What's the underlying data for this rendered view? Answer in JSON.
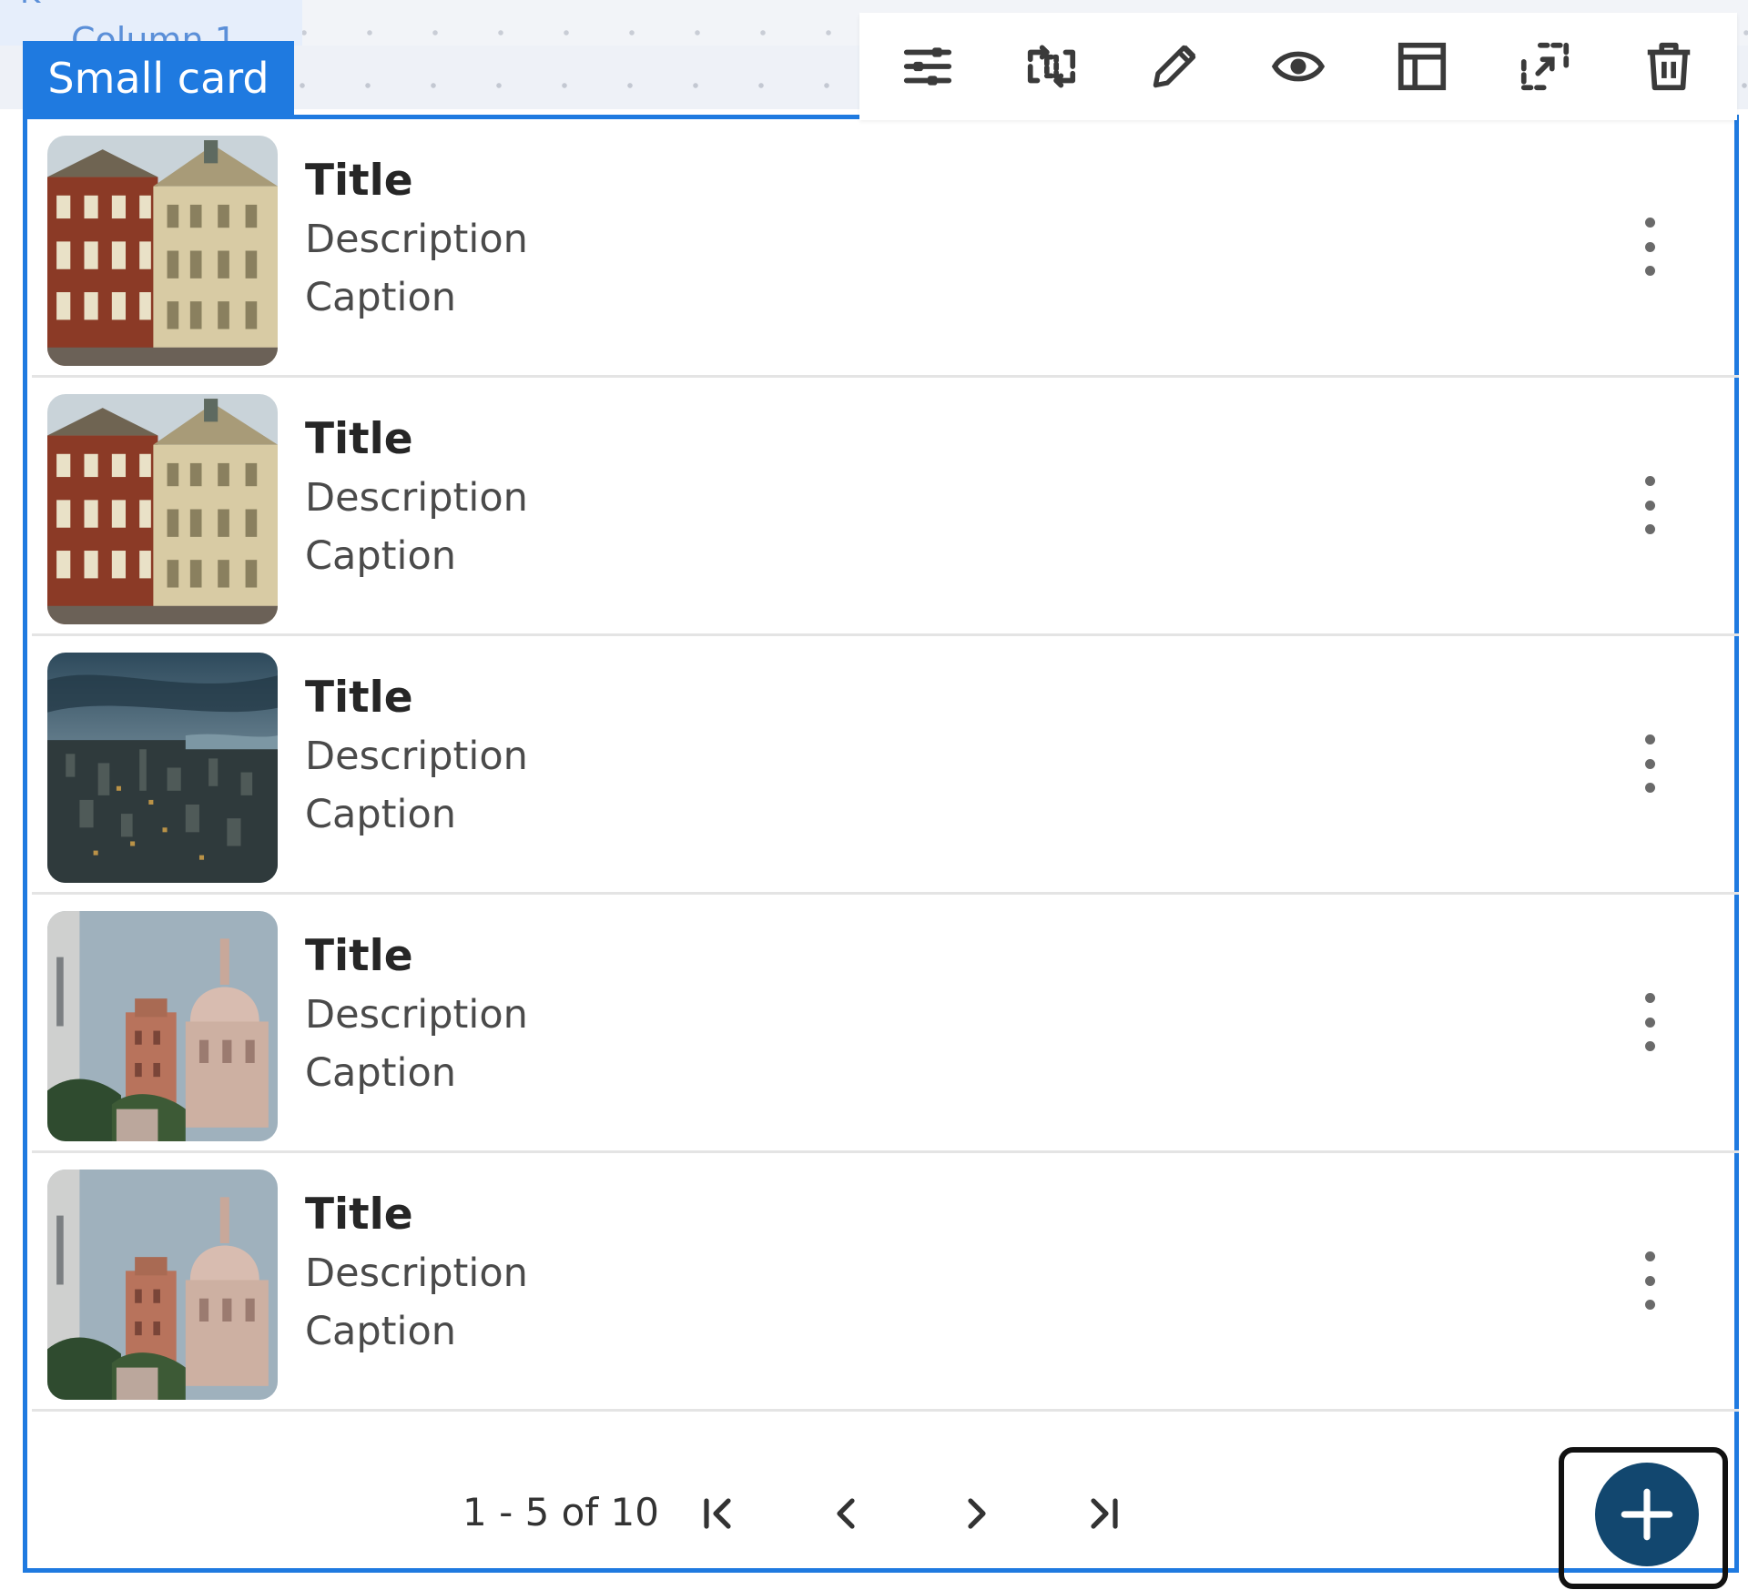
{
  "canvas": {
    "column_letter": "K",
    "column_label": "Column 1"
  },
  "component": {
    "label": "Small card",
    "accent_color": "#1f7ae0"
  },
  "toolbar": {
    "buttons": [
      {
        "name": "settings",
        "icon": "sliders-icon"
      },
      {
        "name": "swap",
        "icon": "swap-icon"
      },
      {
        "name": "edit",
        "icon": "pencil-icon"
      },
      {
        "name": "preview",
        "icon": "eye-icon"
      },
      {
        "name": "layout",
        "icon": "layout-icon"
      },
      {
        "name": "select-parent",
        "icon": "select-parent-icon"
      },
      {
        "name": "delete",
        "icon": "trash-icon"
      }
    ]
  },
  "list": {
    "items": [
      {
        "title": "Title",
        "description": "Description",
        "caption": "Caption",
        "image": "baroque-palace"
      },
      {
        "title": "Title",
        "description": "Description",
        "caption": "Caption",
        "image": "baroque-palace"
      },
      {
        "title": "Title",
        "description": "Description",
        "caption": "Caption",
        "image": "city-skyline"
      },
      {
        "title": "Title",
        "description": "Description",
        "caption": "Caption",
        "image": "domed-church"
      },
      {
        "title": "Title",
        "description": "Description",
        "caption": "Caption",
        "image": "domed-church"
      }
    ],
    "menu_icon": "more-vertical-icon"
  },
  "pagination": {
    "range": "1 - 5 of 10",
    "first_icon": "first-page-icon",
    "prev_icon": "chevron-left-icon",
    "next_icon": "chevron-right-icon",
    "last_icon": "last-page-icon"
  },
  "fab": {
    "icon": "plus-icon",
    "color": "#12476f"
  }
}
